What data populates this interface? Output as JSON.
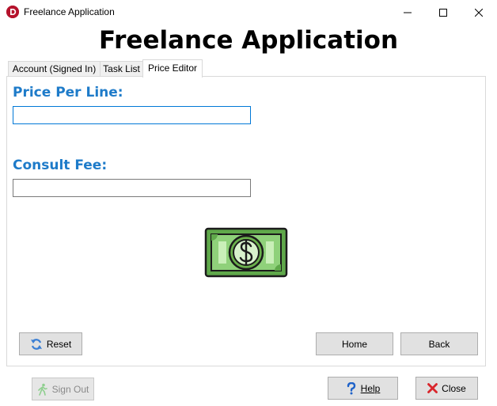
{
  "window": {
    "title": "Freelance Application",
    "controls": [
      "minimize-icon",
      "maximize-icon",
      "close-icon"
    ]
  },
  "header": {
    "title": "Freelance Application"
  },
  "tabs": [
    {
      "label": "Account (Signed In)",
      "selected": false
    },
    {
      "label": "Task List",
      "selected": false
    },
    {
      "label": "Price Editor",
      "selected": true
    }
  ],
  "price_editor": {
    "price_per_line_label": "Price Per Line:",
    "price_per_line_value": "",
    "consult_fee_label": "Consult Fee:",
    "consult_fee_value": "",
    "illustration": "money-bill-icon"
  },
  "buttons": {
    "reset": "Reset",
    "home": "Home",
    "back": "Back",
    "sign_out": "Sign Out",
    "help": "Help",
    "close": "Close"
  },
  "colors": {
    "label_blue": "#1e7bc9",
    "bill_green": "#6ab04c",
    "close_red": "#d9262c",
    "help_blue": "#1e62c9",
    "refresh_blue": "#3b7fd4"
  }
}
